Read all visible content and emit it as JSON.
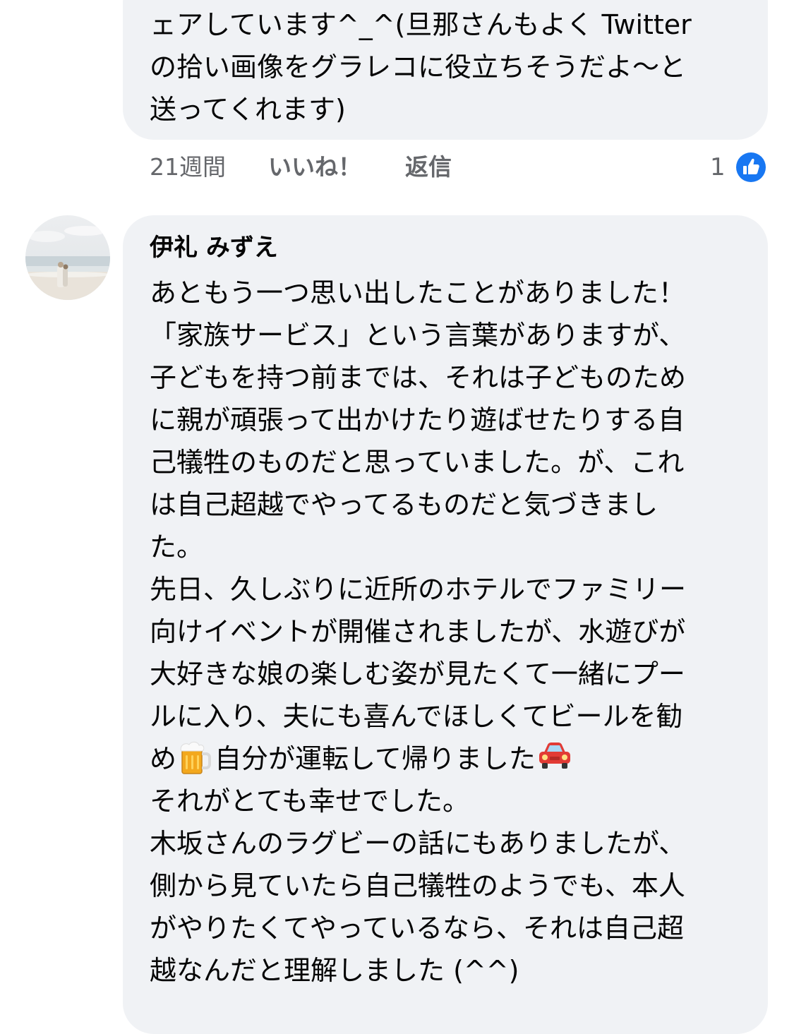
{
  "previous_comment": {
    "text": "ェアしています^_^(旦那さんもよく Twitter\nの拾い画像をグラレコに役立ちそうだよ〜と\n送ってくれます)",
    "timestamp": "21週間",
    "like_label": "いいね！",
    "reply_label": "返信",
    "reaction_count": "1",
    "reaction_icon": "thumbs-up-icon",
    "reaction_color": "#1877f2"
  },
  "comment": {
    "author": "伊礼 みずえ",
    "avatar_icon": "beach-photo-avatar",
    "text_part1": "あともう一つ思い出したことがありました！\n「家族サービス」という言葉がありますが、\n子どもを持つ前までは、それは子どものため\nに親が頑張って出かけたり遊ばせたりする自\n己犠牲のものだと思っていました。が、これ\nは自己超越でやってるものだと気づきまし\nた。\n先日、久しぶりに近所のホテルでファミリー\n向けイベントが開催されましたが、水遊びが\n大好きな娘の楽しむ姿が見たくて一緒にプー\nルに入り、夫にも喜んでほしくてビールを勧",
    "text_part2_a": "め",
    "emoji_beer": "beer-mug-icon",
    "text_part2_b": "自分が運転して帰りました",
    "emoji_car": "red-car-icon",
    "text_part3": "それがとても幸せでした。\n木坂さんのラグビーの話にもありましたが、\n側から見ていたら自己犠牲のようでも、本人\nがやりたくてやっているなら、それは自己超\n越なんだと理解しました (^^)"
  },
  "colors": {
    "bubble_background": "#f0f2f5",
    "secondary_text": "#65676b",
    "primary_text": "#050505",
    "like_blue": "#1877f2"
  }
}
